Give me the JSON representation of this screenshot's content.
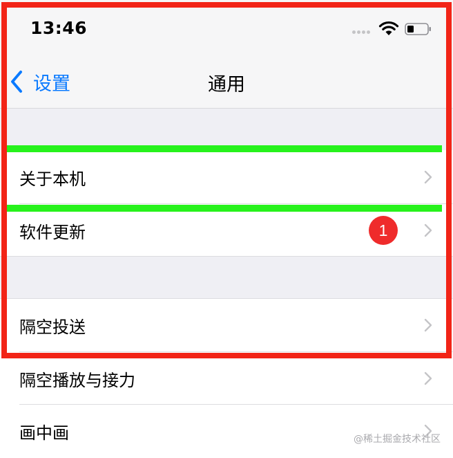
{
  "status_bar": {
    "time": "13:46"
  },
  "nav": {
    "back_label": "设置",
    "title": "通用"
  },
  "rows": [
    {
      "label": "关于本机"
    },
    {
      "label": "软件更新",
      "badge": "1"
    },
    {
      "label": "隔空投送"
    },
    {
      "label": "隔空播放与接力"
    },
    {
      "label": "画中画"
    }
  ],
  "watermark": "@稀土掘金技术社区",
  "colors": {
    "accent": "#0a7aff",
    "badge": "#ef2b2b",
    "highlight_outer": "#f22417",
    "highlight_inner": "#27f21c",
    "group_background": "#efeff4"
  },
  "icons": {
    "back": "chevron-left-icon",
    "disclosure": "chevron-right-icon",
    "wifi": "wifi-icon",
    "battery": "battery-icon"
  }
}
